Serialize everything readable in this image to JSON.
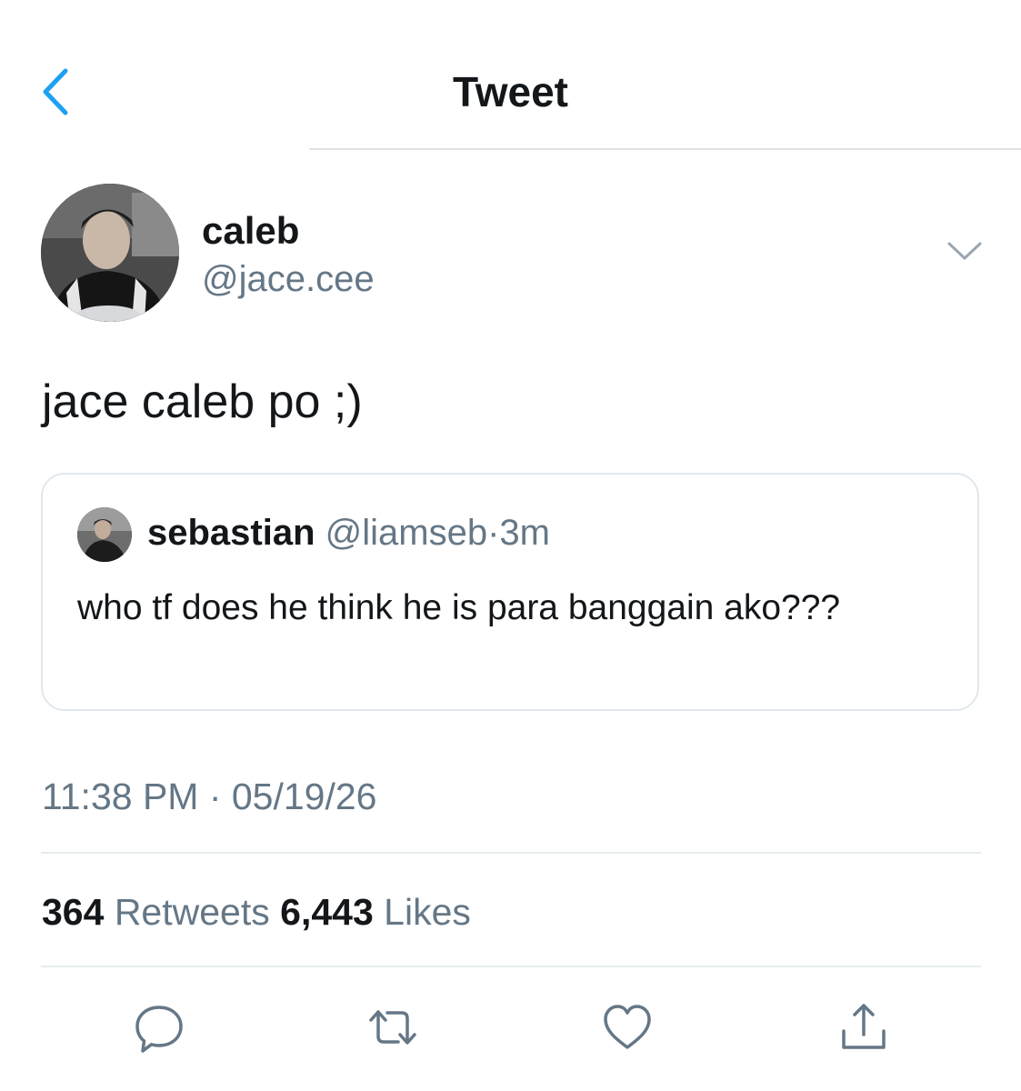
{
  "header": {
    "title": "Tweet",
    "back_icon": "chevron-left-icon",
    "accent_color": "#1da1f2"
  },
  "tweet": {
    "author": {
      "display_name": "caleb",
      "handle": "@jace.cee",
      "avatar": "profile-photo"
    },
    "more_icon": "chevron-down-icon",
    "text": "jace caleb po ;)",
    "quoted": {
      "display_name": "sebastian",
      "handle": "@liamseb",
      "separator": "·",
      "time": "3m",
      "text": "who tf does he think he is para banggain ako???"
    },
    "timestamp": "11:38 PM · 05/19/26",
    "stats": {
      "retweets_count": "364",
      "retweets_label": "Retweets",
      "likes_count": "6,443",
      "likes_label": "Likes"
    },
    "actions": {
      "reply_icon": "reply-icon",
      "retweet_icon": "retweet-icon",
      "like_icon": "heart-icon",
      "share_icon": "share-icon"
    }
  },
  "colors": {
    "text_primary": "#14171a",
    "text_secondary": "#657786",
    "border": "#e1e8ed"
  }
}
